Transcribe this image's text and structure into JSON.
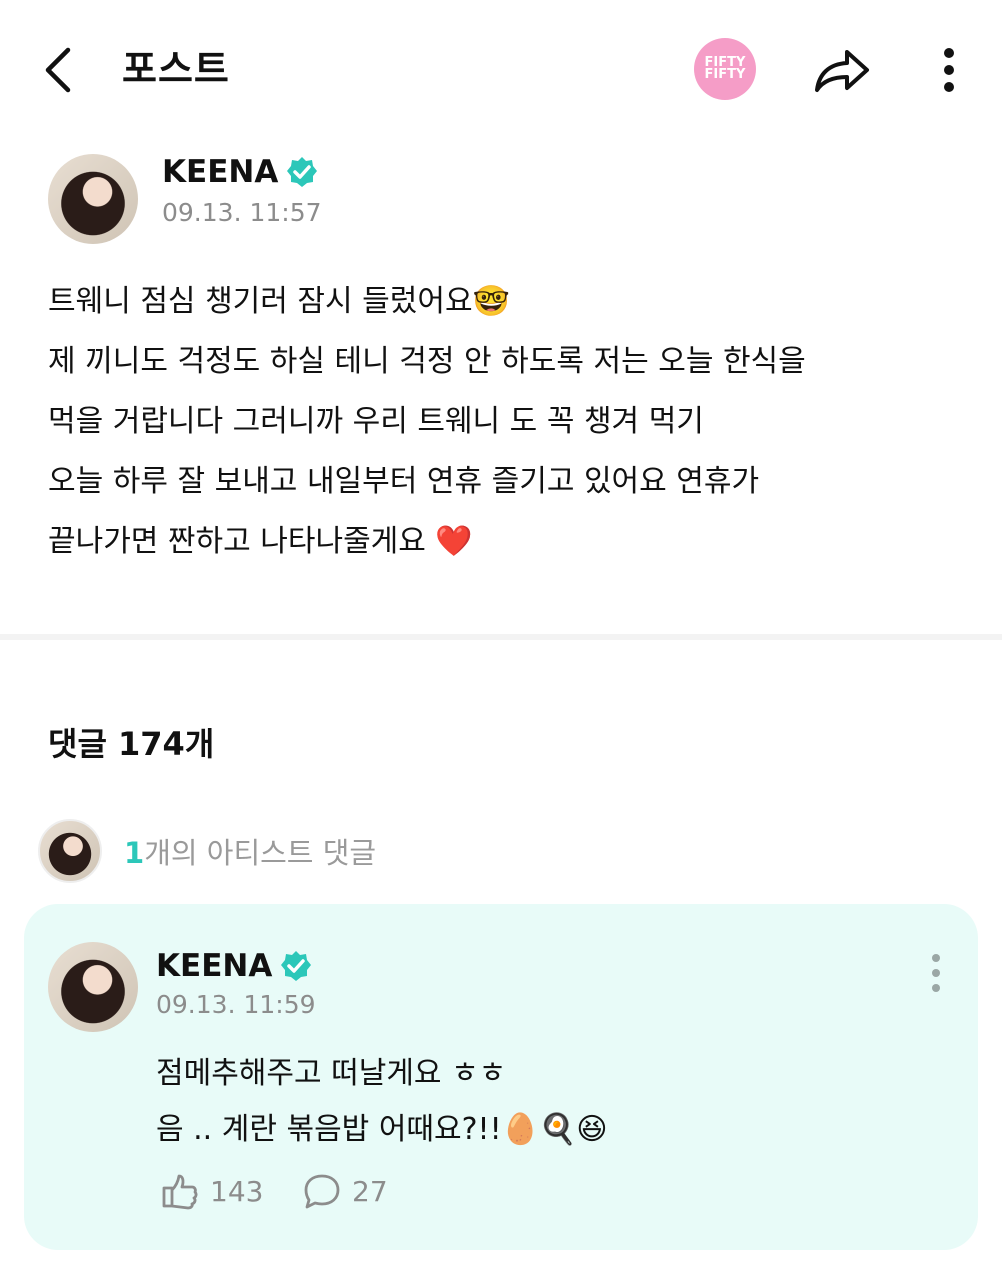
{
  "header": {
    "back_icon": "chevron-left-icon",
    "title": "포스트",
    "group_logo_text": "FIFTY\nFIFTY",
    "share_icon": "share-icon",
    "more_icon": "more-vertical-icon"
  },
  "post": {
    "author": "KEENA",
    "verified_icon": "verified-badge-icon",
    "timestamp": "09.13. 11:57",
    "lines": [
      "트웨니 점심 챙기러 잠시 들렀어요🤓",
      "제 끼니도 걱정도 하실 테니 걱정 안 하도록 저는 오늘 한식을",
      "먹을 거랍니다 그러니까 우리 트웨니 도 꼭 챙겨 먹기",
      "오늘 하루 잘 보내고 내일부터 연휴 즐기고 있어요 연휴가",
      "끝나가면 짠하고 나타나줄게요 ❤️"
    ]
  },
  "comments": {
    "title": "댓글 174개",
    "artist_count": "1",
    "artist_label": "개의 아티스트 댓글"
  },
  "artist_comment": {
    "author": "KEENA",
    "timestamp": "09.13. 11:59",
    "lines": [
      "점메추해주고 떠날게요 ㅎㅎ",
      "음 .. 계란 볶음밥 어때요?!!🥚🍳😆"
    ],
    "like_count": "143",
    "reply_count": "27",
    "like_icon": "like-hand-icon",
    "reply_icon": "comment-bubble-icon",
    "more_icon": "more-vertical-icon"
  },
  "colors": {
    "accent": "#2cc7b9",
    "card_bg": "#e8fbf8",
    "logo_bg": "#f59dc7",
    "muted": "#8c8c8c"
  }
}
